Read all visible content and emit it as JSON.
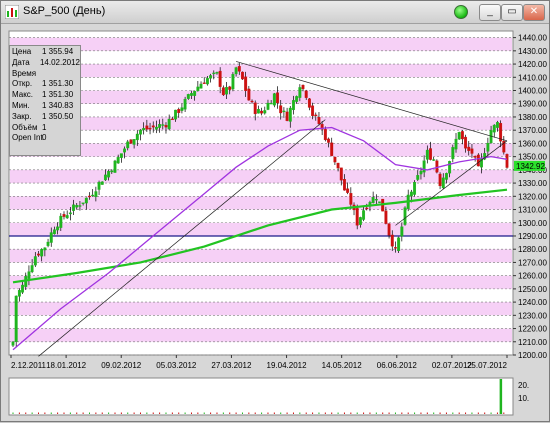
{
  "window": {
    "title": "S&P_500 (День)",
    "buttons": {
      "minimize": "_",
      "restore": "▭",
      "close": "✕"
    }
  },
  "info": [
    {
      "label": "Цена",
      "value": "1 355.94"
    },
    {
      "label": "Дата",
      "value": "14.02.2012"
    },
    {
      "label": "Время",
      "value": ""
    },
    {
      "label": "Откр.",
      "value": "1 351.30"
    },
    {
      "label": "Макс.",
      "value": "1 351.30"
    },
    {
      "label": "Мин.",
      "value": "1 340.83"
    },
    {
      "label": "Закр.",
      "value": "1 350.50"
    },
    {
      "label": "Объём",
      "value": "1"
    },
    {
      "label": "Open Int",
      "value": "0"
    }
  ],
  "current_price_label": "1342.92",
  "volume_labels": [
    "20.",
    "10."
  ],
  "colors": {
    "bull": "#1fb51f",
    "bear": "#cc1111",
    "ma_short": "#a034e0",
    "ma_long": "#22c422",
    "band": "#f6d0f6",
    "hline": "#1a1a8a",
    "price_tag": "#2be12b"
  },
  "chart_data": {
    "type": "candlestick",
    "y_ticks": [
      1200,
      1210,
      1220,
      1230,
      1240,
      1250,
      1260,
      1270,
      1280,
      1290,
      1300,
      1310,
      1320,
      1330,
      1340,
      1350,
      1360,
      1370,
      1380,
      1390,
      1400,
      1410,
      1420,
      1430,
      1440
    ],
    "ylim": [
      1200,
      1445
    ],
    "x_labels": [
      "2.12.2011",
      "18.01.2012",
      "09.02.2012",
      "05.03.2012",
      "27.03.2012",
      "19.04.2012",
      "14.05.2012",
      "06.06.2012",
      "02.07.2012",
      "25.07.2012"
    ],
    "horizontal_line": 1290,
    "anchor_points": [
      [
        0,
        1210
      ],
      [
        1,
        1245
      ],
      [
        3,
        1252
      ],
      [
        5,
        1265
      ],
      [
        7,
        1275
      ],
      [
        10,
        1282
      ],
      [
        13,
        1297
      ],
      [
        16,
        1305
      ],
      [
        20,
        1313
      ],
      [
        24,
        1320
      ],
      [
        28,
        1333
      ],
      [
        32,
        1345
      ],
      [
        36,
        1360
      ],
      [
        40,
        1370
      ],
      [
        44,
        1372
      ],
      [
        48,
        1375
      ],
      [
        52,
        1385
      ],
      [
        56,
        1398
      ],
      [
        60,
        1408
      ],
      [
        64,
        1412
      ],
      [
        66,
        1398
      ],
      [
        68,
        1402
      ],
      [
        70,
        1417
      ],
      [
        72,
        1408
      ],
      [
        74,
        1393
      ],
      [
        76,
        1385
      ],
      [
        78,
        1383
      ],
      [
        80,
        1390
      ],
      [
        82,
        1397
      ],
      [
        84,
        1385
      ],
      [
        86,
        1380
      ],
      [
        88,
        1392
      ],
      [
        90,
        1405
      ],
      [
        92,
        1397
      ],
      [
        94,
        1382
      ],
      [
        96,
        1375
      ],
      [
        98,
        1365
      ],
      [
        100,
        1353
      ],
      [
        102,
        1340
      ],
      [
        104,
        1325
      ],
      [
        106,
        1315
      ],
      [
        108,
        1300
      ],
      [
        110,
        1310
      ],
      [
        112,
        1317
      ],
      [
        114,
        1320
      ],
      [
        116,
        1310
      ],
      [
        118,
        1292
      ],
      [
        120,
        1278
      ],
      [
        122,
        1297
      ],
      [
        124,
        1320
      ],
      [
        126,
        1328
      ],
      [
        128,
        1340
      ],
      [
        130,
        1353
      ],
      [
        132,
        1348
      ],
      [
        134,
        1330
      ],
      [
        136,
        1340
      ],
      [
        138,
        1355
      ],
      [
        140,
        1370
      ],
      [
        142,
        1355
      ],
      [
        144,
        1353
      ],
      [
        146,
        1340
      ],
      [
        148,
        1355
      ],
      [
        150,
        1370
      ],
      [
        152,
        1375
      ],
      [
        154,
        1353
      ],
      [
        155,
        1343
      ]
    ],
    "ma_short": [
      [
        0,
        1204
      ],
      [
        15,
        1235
      ],
      [
        30,
        1262
      ],
      [
        45,
        1292
      ],
      [
        60,
        1322
      ],
      [
        70,
        1342
      ],
      [
        80,
        1358
      ],
      [
        90,
        1370
      ],
      [
        100,
        1372
      ],
      [
        110,
        1362
      ],
      [
        120,
        1344
      ],
      [
        130,
        1340
      ],
      [
        140,
        1346
      ],
      [
        150,
        1350
      ],
      [
        155,
        1348
      ]
    ],
    "ma_long": [
      [
        0,
        1255
      ],
      [
        20,
        1262
      ],
      [
        40,
        1270
      ],
      [
        60,
        1282
      ],
      [
        80,
        1298
      ],
      [
        100,
        1310
      ],
      [
        120,
        1315
      ],
      [
        140,
        1321
      ],
      [
        155,
        1325
      ]
    ],
    "trendlines": [
      [
        [
          70,
          1422
        ],
        [
          155,
          1362
        ]
      ],
      [
        [
          8,
          1199
        ],
        [
          98,
          1378
        ]
      ],
      [
        [
          120,
          1298
        ],
        [
          155,
          1362
        ]
      ]
    ]
  }
}
